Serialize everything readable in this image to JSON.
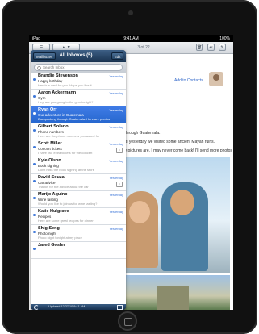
{
  "status": {
    "carrier": "iPad",
    "time": "9:41 AM",
    "battery": "100%"
  },
  "toolbar": {
    "counter": "3 of 22"
  },
  "mailbox": {
    "back_label": "Mailboxes",
    "title": "All Inboxes (5)",
    "edit_label": "Edit"
  },
  "search": {
    "placeholder": "Search Inbox"
  },
  "messages": [
    {
      "sender": "Brandie Stevenson",
      "subject": "Happy birthday",
      "preview": "Here's a card for you. Hope you like it",
      "time": "Yesterday"
    },
    {
      "sender": "Aaron Ackermann",
      "subject": "Gym",
      "preview": "Hey, are you going to the gym tonight?",
      "time": "Yesterday"
    },
    {
      "sender": "Ryan Orr",
      "subject": "Our adventure in Guatemala",
      "preview": "Backpacking through Guatemala. Here are photos",
      "time": "Yesterday"
    },
    {
      "sender": "Gilbert Solano",
      "subject": "Phone numbers",
      "preview": "Here are the phone numbers you asked for",
      "time": "Yesterday"
    },
    {
      "sender": "Scott Miller",
      "subject": "Concert tickets",
      "preview": "I have two extra tickets for the concert",
      "time": "Yesterday"
    },
    {
      "sender": "Kyle Olson",
      "subject": "Book signing",
      "preview": "Don't miss the book signing at the store",
      "time": "Yesterday"
    },
    {
      "sender": "David Souza",
      "subject": "Car advice",
      "preview": "Thanks for the advice about the car",
      "time": "Yesterday"
    },
    {
      "sender": "Marijo Aquino",
      "subject": "Wine tasting",
      "preview": "Would you like to join us for wine tasting?",
      "time": "Yesterday"
    },
    {
      "sender": "Katie Hulgrave",
      "subject": "Recipes",
      "preview": "Here are some great recipes for dinner",
      "time": "Yesterday"
    },
    {
      "sender": "Shig Seng",
      "subject": "Photo night",
      "preview": "Photo night tonight at my place",
      "time": "Yesterday"
    },
    {
      "sender": "Jared Gosler",
      "subject": "",
      "preview": "",
      "time": ""
    }
  ],
  "reading_pane": {
    "add_contact": "Add to Contacts",
    "line1": "trip through Guatemala.",
    "line2": "...and yesterday we visited some ancient Mayan ruins.",
    "line3": "...ary pictures are. I may never come back! I'll send more photos"
  },
  "footer": {
    "updated": "Updated 12/27/10 9:41 AM"
  }
}
